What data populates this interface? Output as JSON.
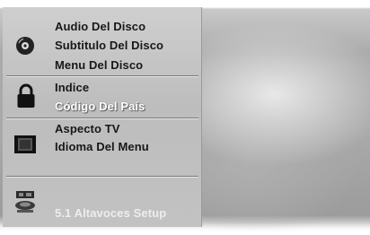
{
  "menu": {
    "groups": [
      {
        "icon": "disc-icon",
        "items": [
          "Audio Del Disco",
          "Subtitulo Del Disco",
          "Menu Del Disco"
        ]
      },
      {
        "icon": "lock-icon",
        "items": [
          "Indice",
          "Código Del País"
        ],
        "selected_item": "Código Del País"
      },
      {
        "icon": "tv-screen-icon",
        "items": [
          "Aspecto TV",
          "Idioma Del Menu"
        ]
      },
      {
        "icon": "speaker-setup-icon",
        "items": [
          "5.1 Altavoces Setup"
        ]
      }
    ]
  }
}
